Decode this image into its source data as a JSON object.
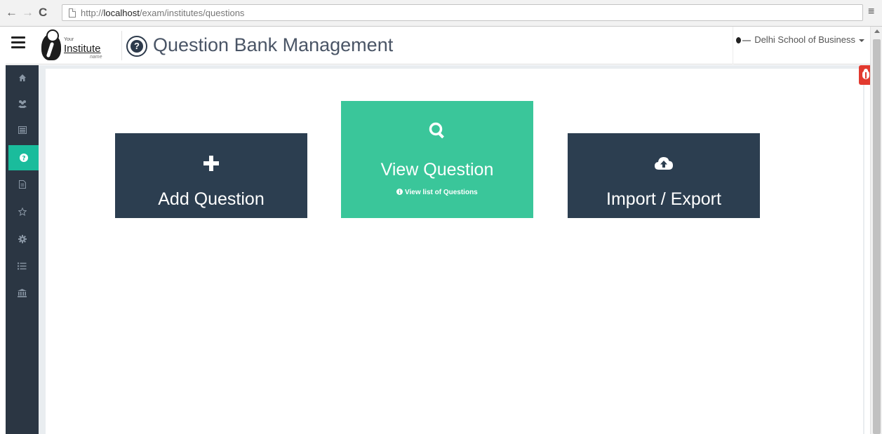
{
  "browser": {
    "url_protocol": "http://",
    "url_host": "localhost",
    "url_path": "/exam/institutes/questions"
  },
  "header": {
    "logo": {
      "your": "Your",
      "institute": "Institute",
      "name": "name"
    },
    "title": "Question Bank Management",
    "institute_selector": "Delhi School of Business"
  },
  "sidebar": {
    "items": [
      {
        "icon": "home-icon",
        "active": false
      },
      {
        "icon": "users-icon",
        "active": false
      },
      {
        "icon": "list-box-icon",
        "active": false
      },
      {
        "icon": "question-circle-icon",
        "active": true
      },
      {
        "icon": "document-icon",
        "active": false
      },
      {
        "icon": "star-icon",
        "active": false
      },
      {
        "icon": "gear-icon",
        "active": false
      },
      {
        "icon": "list-icon",
        "active": false
      },
      {
        "icon": "institution-icon",
        "active": false
      }
    ]
  },
  "tiles": [
    {
      "title": "Add Question",
      "icon": "plus-icon",
      "color": "#2c3e50"
    },
    {
      "title": "View Question",
      "subtitle": "View list of Questions",
      "icon": "search-icon",
      "color": "#3ac69a"
    },
    {
      "title": "Import / Export",
      "icon": "cloud-upload-icon",
      "color": "#2c3e50"
    }
  ],
  "colors": {
    "sidebar": "#2b3643",
    "accent": "#1abc9c",
    "tile_dark": "#2c3e50",
    "tile_green": "#3ac69a",
    "bug": "#e23a2f"
  }
}
